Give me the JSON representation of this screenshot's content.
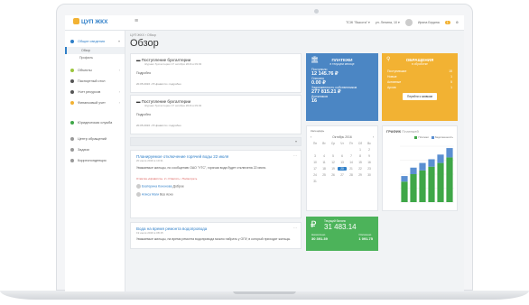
{
  "topbar": {
    "logo": "ЦУП ЖКХ",
    "company": "ТСЖ \"Высота\" ▾",
    "location": "ул. Ленина, 10 ▾",
    "user": "Ирина Бедина",
    "user_badge": "1"
  },
  "sidebar": {
    "items": [
      {
        "label": "Общие сведения",
        "color": "#2f7fc8"
      },
      {
        "label": "Объекты",
        "color": "#9bc53d"
      },
      {
        "label": "Паспортный стол",
        "color": "#555555"
      },
      {
        "label": "Учет ресурсов",
        "color": "#555555"
      },
      {
        "label": "Финансовый учет",
        "color": "#f2b233"
      },
      {
        "label": "Юридическая служба",
        "color": "#3fa748"
      },
      {
        "label": "Центр обращений",
        "color": "#555555"
      },
      {
        "label": "Задачи",
        "color": "#555555"
      },
      {
        "label": "Корреспонденция",
        "color": "#555555"
      }
    ],
    "sub_overview": "Обзор",
    "sub_profile": "Профиль"
  },
  "breadcrumb": "ЦУП ЖКХ  ›  Обзор",
  "page_title": "Обзор",
  "feed": {
    "post1": {
      "title": "Поступление бухгалтерии",
      "sub": "Журнал бухгалтерии 17 октября 2016 в 09:03",
      "body": "Подробно",
      "meta": "20.05.2016  •  ♥ Нравится  •  подробно"
    },
    "post2": {
      "title": "Поступление бухгалтерии",
      "sub": "Журнал бухгалтерии 17 октября 2016 в 09:03",
      "body": "Подробно",
      "meta": "20.05.2016  •  ♥ Нравится  •  подробно"
    },
    "comment_placeholder": "Добавить новость",
    "news1": {
      "title": "Планируемое отключение горячей воды 22 июля",
      "date": "20 июля 2016 в 10:31",
      "body": "Уважаемые жильцы, по сообщению ОАО \"УТС\", горячая вода будет отключена 22 июля.",
      "meta": "Отметка «Нравится»: 2  •  Ответить  •  Посмотреть",
      "commenter1": "Екатерина Кононова",
      "comment1": "Доброе",
      "commenter2": "Алиса Маги",
      "comment2": "Все ясно"
    },
    "news2": {
      "title": "Вода на время ремонта водопровода",
      "date": "19 июля 2016 в 08:15",
      "body": "Уважаемые жильцы, на время ремонта водопровода можно набрать у ОПУ, в который приходят жильцы."
    }
  },
  "payments": {
    "title": "ПЛАТЕЖИ",
    "sub": "в текущем месяце",
    "l1": "Поступило",
    "v1": "12 145.76 ₽",
    "l2": "Списано",
    "v2": "0.00 ₽",
    "l3": "Задолженность собственников",
    "v3": "277 815.21 ₽",
    "l4": "Должников",
    "v4": "16"
  },
  "requests": {
    "title": "ОБРАЩЕНИЯ",
    "sub": "в обработке",
    "rows": [
      {
        "label": "Поступившие",
        "value": "15"
      },
      {
        "label": "Новые",
        "value": "1"
      },
      {
        "label": "Активные",
        "value": "5"
      },
      {
        "label": "Архив",
        "value": "1"
      }
    ],
    "button": "Перейти к заявкам"
  },
  "calendar": {
    "title": "Календарь",
    "month": "Октябрь 2016",
    "days": [
      "Пн",
      "Вт",
      "Ср",
      "Чт",
      "Пт",
      "Сб",
      "Вс"
    ],
    "dates": [
      "",
      "",
      "",
      "",
      "",
      "1",
      "2",
      "3",
      "4",
      "5",
      "6",
      "7",
      "8",
      "9",
      "10",
      "11",
      "12",
      "13",
      "14",
      "15",
      "16",
      "17",
      "18",
      "19",
      "20",
      "21",
      "22",
      "23",
      "24",
      "25",
      "26",
      "27",
      "28",
      "29",
      "30",
      "31",
      "",
      "",
      "",
      "",
      "",
      ""
    ],
    "today": "20"
  },
  "balance": {
    "label": "Текущий баланс",
    "amount": "31 483.14",
    "l1": "Начислено",
    "v1": "30 391.39",
    "l2": "Оплачено",
    "v2": "1 091.75"
  },
  "chart_data": {
    "type": "bar",
    "title": "ГРАФИК",
    "subtitle": "Платежей",
    "series": [
      {
        "name": "Платежи",
        "color": "#3fa748",
        "values": [
          22,
          30,
          34,
          38,
          42,
          48
        ]
      },
      {
        "name": "Задолженность",
        "color": "#5b8fd1",
        "values": [
          6,
          7,
          8,
          8,
          9,
          10
        ]
      }
    ],
    "categories": [
      "",
      "",
      "",
      "",
      "",
      ""
    ],
    "ylim": [
      0,
      60
    ]
  }
}
